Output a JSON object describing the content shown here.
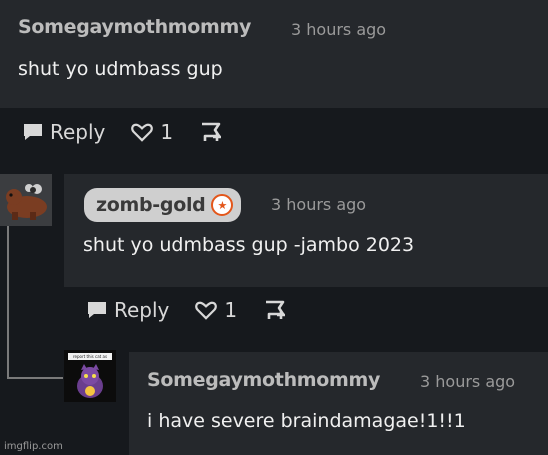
{
  "comments": [
    {
      "username": "Somegaymothmommy",
      "time": "3 hours ago",
      "text": "shut yo udmbass gup",
      "actions": {
        "reply_label": "Reply",
        "like_count": "1"
      }
    },
    {
      "username": "zomb-gold",
      "time": "3 hours ago",
      "text": "shut yo udmbass gup -jambo 2023",
      "avatar_icon": "brown-bear-avatar",
      "badge_icon": "gold-badge-icon",
      "actions": {
        "reply_label": "Reply",
        "like_count": "1"
      }
    },
    {
      "username": "Somegaymothmommy",
      "time": "3 hours ago",
      "text": "i have severe braindamagae!1!!1",
      "avatar_icon": "moth-avatar",
      "avatar_caption": "report this cat as sight"
    }
  ],
  "watermark": "imgflip.com",
  "colors": {
    "page_bg": "#16191d",
    "comment_bg": "#25282c",
    "badge_accent": "#e3561a"
  }
}
